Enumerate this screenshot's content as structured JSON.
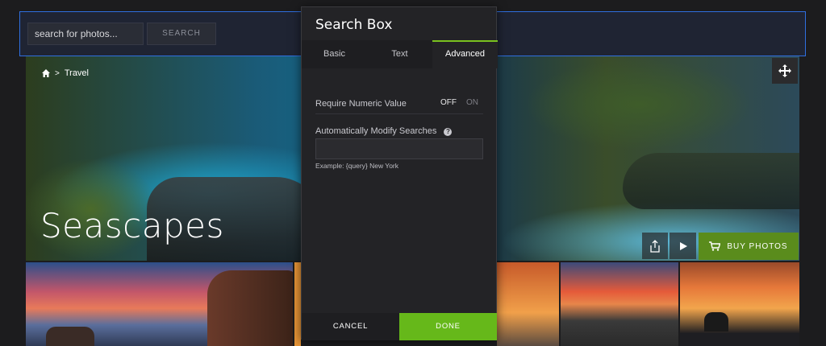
{
  "search_bar": {
    "input_value": "search for photos...",
    "button_label": "SEARCH"
  },
  "hero": {
    "breadcrumb": "Travel",
    "title": "Seascapes",
    "buy_label": "BUY PHOTOS"
  },
  "icons": {
    "home": "home-icon",
    "move": "move-icon",
    "share": "share-icon",
    "play": "play-icon",
    "cart": "cart-icon",
    "help": "help-icon"
  },
  "dialog": {
    "title": "Search Box",
    "tabs": [
      {
        "label": "Basic"
      },
      {
        "label": "Text"
      },
      {
        "label": "Advanced",
        "active": true
      }
    ],
    "require_numeric_label": "Require Numeric Value",
    "toggle_off": "OFF",
    "toggle_on": "ON",
    "modify_label": "Automatically Modify Searches",
    "modify_help": "?",
    "modify_value": "",
    "example_text": "Example: {query} New York",
    "cancel_label": "CANCEL",
    "done_label": "DONE"
  },
  "colors": {
    "accent_green": "#66b81a",
    "buy_green": "#5a8c1c",
    "selection_blue": "#2f6fe0"
  }
}
